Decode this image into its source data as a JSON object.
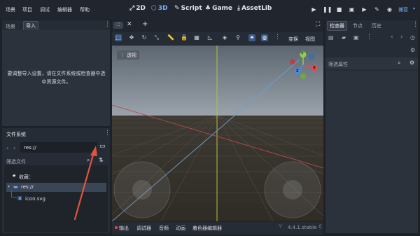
{
  "menu": [
    "场景",
    "项目",
    "调试",
    "编辑器",
    "帮助"
  ],
  "workspaces": [
    {
      "icon": "2d-icon",
      "label": "2D",
      "active": false
    },
    {
      "icon": "3d-icon",
      "label": "3D",
      "active": true
    },
    {
      "icon": "script-icon",
      "label": "Script",
      "active": false
    },
    {
      "icon": "game-icon",
      "label": "Game",
      "active": false
    },
    {
      "icon": "assetlib-icon",
      "label": "AssetLib",
      "active": false
    }
  ],
  "renderer": "兼容",
  "left_dock": {
    "tabs": [
      "场景",
      "导入"
    ],
    "import_message": "要调整导入设置，请在文件系统或检查器中选中资源文件。"
  },
  "filesystem": {
    "title": "文件系统",
    "path": "res://",
    "filter_placeholder": "筛选文件",
    "favorites_label": "收藏：",
    "root": "res://",
    "files": [
      "icon.svg"
    ]
  },
  "viewport": {
    "toolbar_right": [
      "变换",
      "视图"
    ],
    "view_label": "透视",
    "gizmo_axes": [
      "X",
      "Y",
      "Z"
    ]
  },
  "inspector": {
    "tabs": [
      "检查器",
      "节点",
      "历史"
    ],
    "filter_placeholder": "筛选属性"
  },
  "bottom_panel": {
    "tabs": [
      "输出",
      "调试器",
      "音频",
      "动画",
      "着色器编辑器"
    ],
    "version": "4.4.1.stable"
  },
  "colors": {
    "accent": "#6fb0ff",
    "x_axis": "#e04a55",
    "y_axis": "#8bd14e",
    "z_axis": "#4a8ae0",
    "arrow": "#e2533e"
  }
}
